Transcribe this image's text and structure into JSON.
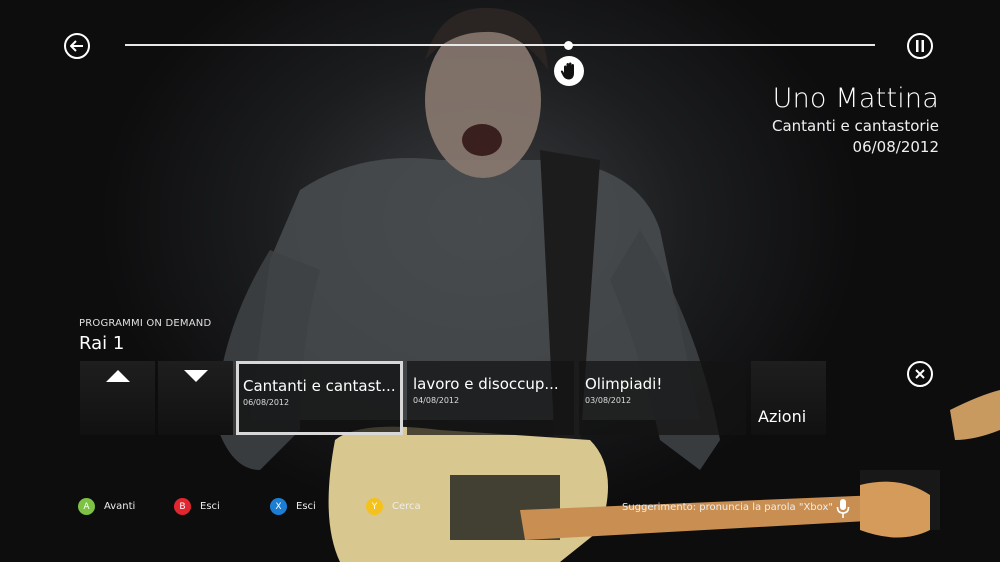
{
  "player": {
    "progress": 0.59,
    "icons": {
      "back": "back-arrow-icon",
      "pause": "pause-icon",
      "cursor": "hand-cursor-icon",
      "close": "close-icon"
    }
  },
  "now_playing": {
    "show_title": "Uno Mattina",
    "episode_title": "Cantanti e cantastorie",
    "episode_date": "06/08/2012"
  },
  "browse": {
    "section_label": "PROGRAMMI ON DEMAND",
    "channel": "Rai 1",
    "episodes": [
      {
        "title": "Cantanti e cantast...",
        "date": "06/08/2012",
        "selected": true
      },
      {
        "title": "lavoro e disoccup...",
        "date": "04/08/2012",
        "selected": false
      },
      {
        "title": "Olimpiadi!",
        "date": "03/08/2012",
        "selected": false
      }
    ],
    "actions_label": "Azioni"
  },
  "footer": {
    "hints": [
      {
        "button": "A",
        "label": "Avanti",
        "color": "#7dc243"
      },
      {
        "button": "B",
        "label": "Esci",
        "color": "#e3262e"
      },
      {
        "button": "X",
        "label": "Esci",
        "color": "#1a7fd4"
      },
      {
        "button": "Y",
        "label": "Cerca",
        "color": "#f5c21b"
      }
    ],
    "voice_hint": "Suggerimento: pronuncia la parola \"Xbox\""
  }
}
